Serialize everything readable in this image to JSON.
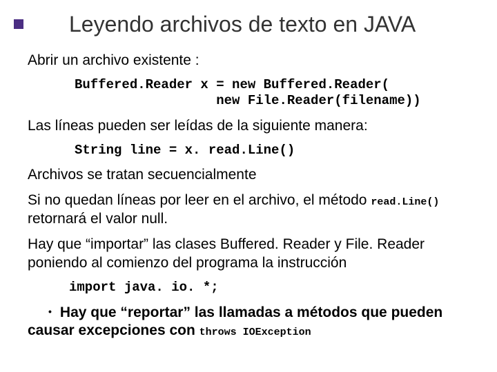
{
  "title": "Leyendo archivos de texto en JAVA",
  "p1": "Abrir un archivo existente :",
  "code1": "Buffered.Reader x = new Buffered.Reader(\n                  new File.Reader(filename))",
  "p2": "Las líneas pueden ser leídas de la siguiente manera:",
  "code2": "String line = x. read.Line()",
  "p3": "Archivos se tratan secuencialmente",
  "p4a": "Si no quedan líneas por leer en el archivo, el método ",
  "p4code": "read.Line()",
  "p4b": " retornará el valor null.",
  "p5": "Hay que “importar” las clases Buffered. Reader y File. Reader poniendo al comienzo del programa la instrucción",
  "code3": "import java. io. *;",
  "p6a": "Hay que “reportar” las llamadas a métodos que pueden causar excepciones con ",
  "p6code": "throws IOException"
}
